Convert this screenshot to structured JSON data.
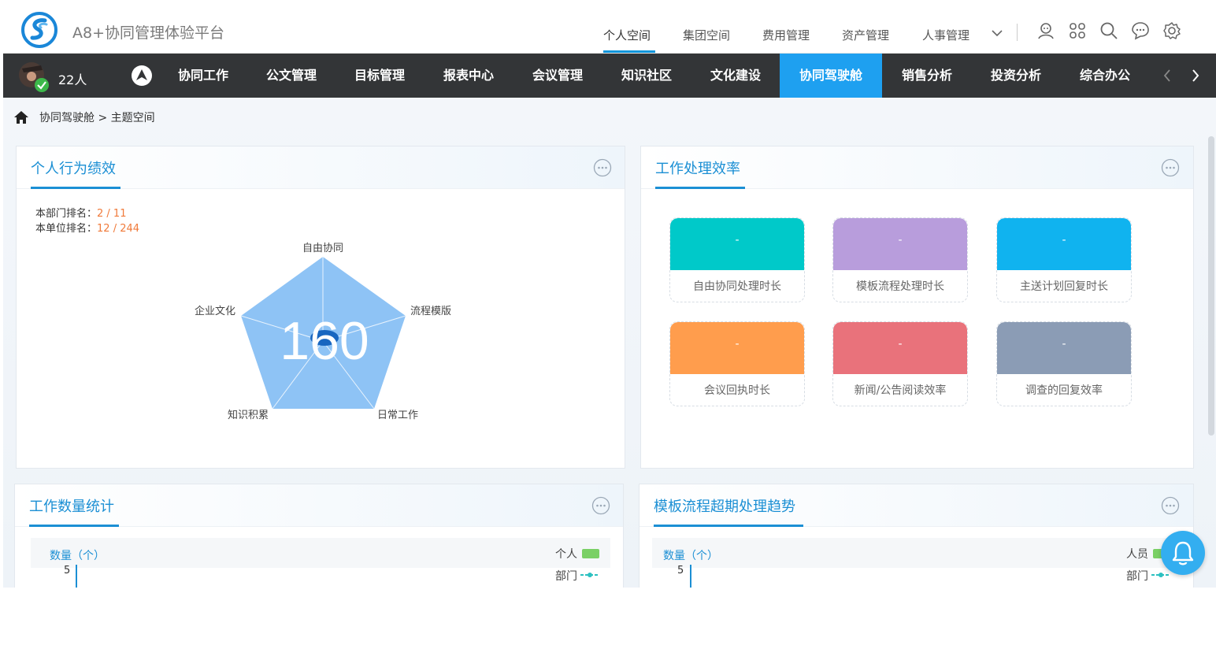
{
  "header": {
    "title": "A8+协同管理体验平台",
    "tabs": [
      "个人空间",
      "集团空间",
      "费用管理",
      "资产管理",
      "人事管理"
    ]
  },
  "nav": {
    "user_count": "22人",
    "items": [
      "协同工作",
      "公文管理",
      "目标管理",
      "报表中心",
      "会议管理",
      "知识社区",
      "文化建设",
      "协同驾驶舱",
      "销售分析",
      "投资分析",
      "综合办公"
    ],
    "active_index": 7
  },
  "breadcrumb": "协同驾驶舱 > 主题空间",
  "personal_panel": {
    "title": "个人行为绩效",
    "dept_rank_label": "本部门排名：",
    "dept_rank_value": "2 / 11",
    "unit_rank_label": "本单位排名：",
    "unit_rank_value": "12 / 244",
    "score": "160",
    "radar_axes": [
      "自由协同",
      "流程模版",
      "日常工作",
      "知识积累",
      "企业文化"
    ]
  },
  "efficiency_panel": {
    "title": "工作处理效率",
    "tiles": [
      {
        "value": "-",
        "label": "自由协同处理时长",
        "color": "#00c9c9"
      },
      {
        "value": "-",
        "label": "模板流程处理时长",
        "color": "#b89ddc"
      },
      {
        "value": "-",
        "label": "主送计划回复时长",
        "color": "#10b3ef"
      },
      {
        "value": "-",
        "label": "会议回执时长",
        "color": "#ff9d4d"
      },
      {
        "value": "-",
        "label": "新闻/公告阅读效率",
        "color": "#e9727b"
      },
      {
        "value": "-",
        "label": "调查的回复效率",
        "color": "#8b9cb5"
      }
    ]
  },
  "work_count_panel": {
    "title": "工作数量统计",
    "ylabel": "数量（个）",
    "ytick_top": "5",
    "legend_a": "个人",
    "legend_b": "部门"
  },
  "overdue_panel": {
    "title": "模板流程超期处理趋势",
    "ylabel": "数量（个）",
    "ytick_top": "5",
    "legend_a": "人员",
    "legend_b": "部门"
  }
}
